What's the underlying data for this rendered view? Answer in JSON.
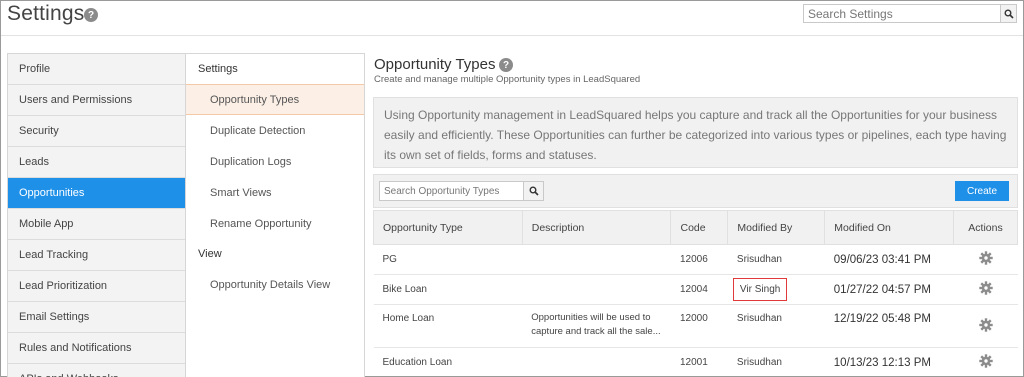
{
  "header": {
    "title": "Settings",
    "search_placeholder": "Search Settings"
  },
  "left_nav": {
    "items": [
      {
        "label": "Profile",
        "active": false
      },
      {
        "label": "Users and Permissions",
        "active": false
      },
      {
        "label": "Security",
        "active": false
      },
      {
        "label": "Leads",
        "active": false
      },
      {
        "label": "Opportunities",
        "active": true
      },
      {
        "label": "Mobile App",
        "active": false
      },
      {
        "label": "Lead Tracking",
        "active": false
      },
      {
        "label": "Lead Prioritization",
        "active": false
      },
      {
        "label": "Email Settings",
        "active": false
      },
      {
        "label": "Rules and Notifications",
        "active": false
      },
      {
        "label": "APIs and Webhooks",
        "active": false
      }
    ]
  },
  "sub_nav": {
    "settings_heading": "Settings",
    "settings_items": [
      {
        "label": "Opportunity Types",
        "active": true
      },
      {
        "label": "Duplicate Detection",
        "active": false
      },
      {
        "label": "Duplication Logs",
        "active": false
      },
      {
        "label": "Smart Views",
        "active": false
      },
      {
        "label": "Rename Opportunity",
        "active": false
      }
    ],
    "view_heading": "View",
    "view_items": [
      {
        "label": "Opportunity Details View",
        "active": false
      }
    ]
  },
  "main": {
    "title": "Opportunity Types",
    "subtitle": "Create and manage multiple Opportunity types in LeadSquared",
    "info": "Using Opportunity management in LeadSquared helps you capture and track all the Opportunities for your business easily and efficiently. These Opportunities can further be categorized into various types or pipelines, each type having its own set of fields, forms and statuses.",
    "search_placeholder": "Search Opportunity Types",
    "create_label": "Create",
    "columns": [
      "Opportunity Type",
      "Description",
      "Code",
      "Modified By",
      "Modified On",
      "Actions"
    ],
    "rows": [
      {
        "type": "PG",
        "description": "",
        "code": "12006",
        "modified_by": "Srisudhan",
        "modified_on": "09/06/23 03:41 PM"
      },
      {
        "type": "Bike Loan",
        "description": "",
        "code": "12004",
        "modified_by": "Vir Singh",
        "modified_on": "01/27/22 04:57 PM",
        "highlighted": true
      },
      {
        "type": "Home Loan",
        "description": "Opportunities will be used to capture and track all the sale...",
        "code": "12000",
        "modified_by": "Srisudhan",
        "modified_on": "12/19/22 05:48 PM"
      },
      {
        "type": "Education Loan",
        "description": "",
        "code": "12001",
        "modified_by": "Srisudhan",
        "modified_on": "10/13/23 12:13 PM"
      }
    ]
  },
  "colors": {
    "accent": "#1e90e8",
    "active_sub_bg": "#fcefe6",
    "highlight_border": "#e03a3a"
  },
  "icons": {
    "help": "help-circle-icon",
    "search": "search-icon",
    "actions": "gear-icon"
  }
}
